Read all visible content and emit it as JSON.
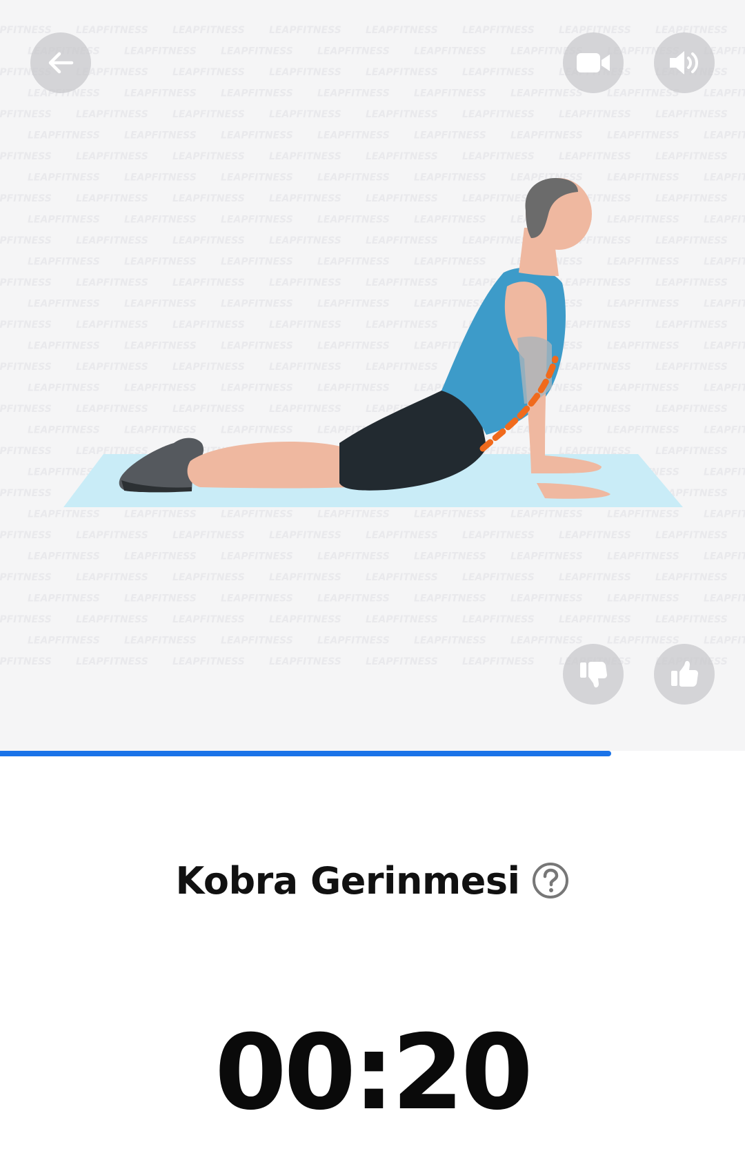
{
  "watermark_text": "LEAPFITNESS",
  "exercise": {
    "title": "Kobra Gerinmesi",
    "timer": "00:20"
  },
  "progress": {
    "fraction": 0.82,
    "color": "#1a73e8"
  },
  "icons": {
    "back": "arrow-left-icon",
    "video": "video-camera-icon",
    "sound": "speaker-volume-icon",
    "dislike": "thumbs-down-icon",
    "like": "thumbs-up-icon",
    "help": "question-circle-icon"
  },
  "colors": {
    "stage_bg": "#f5f5f6",
    "button_bg": "#c8c8cc",
    "mat": "#c9ecf7",
    "shirt": "#3d9bc9",
    "shorts": "#222a30",
    "skin": "#efb8a0",
    "hair": "#6b6b6b",
    "spine_highlight": "#f06a1c"
  }
}
